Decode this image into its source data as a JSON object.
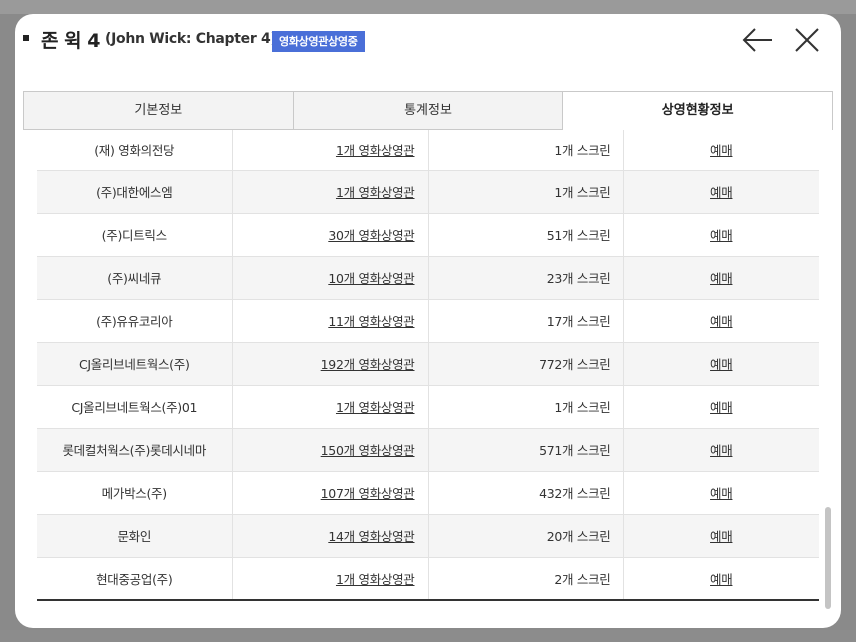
{
  "header": {
    "title": "존 윅 4",
    "subtitle": "(John Wick: Chapter 4)",
    "badge": "영화상영관상영중"
  },
  "tabs": [
    {
      "label": "기본정보",
      "active": false
    },
    {
      "label": "통계정보",
      "active": false
    },
    {
      "label": "상영현황정보",
      "active": true
    }
  ],
  "rows": [
    {
      "company": "(재) 영화의전당",
      "theaters": "1개 영화상영관",
      "screens": "1개 스크린",
      "action": "예매"
    },
    {
      "company": "(주)대한에스엠",
      "theaters": "1개 영화상영관",
      "screens": "1개 스크린",
      "action": "예매"
    },
    {
      "company": "(주)디트릭스",
      "theaters": "30개 영화상영관",
      "screens": "51개 스크린",
      "action": "예매"
    },
    {
      "company": "(주)씨네큐",
      "theaters": "10개 영화상영관",
      "screens": "23개 스크린",
      "action": "예매"
    },
    {
      "company": "(주)유유코리아",
      "theaters": "11개 영화상영관",
      "screens": "17개 스크린",
      "action": "예매"
    },
    {
      "company": "CJ올리브네트웍스(주)",
      "theaters": "192개 영화상영관",
      "screens": "772개 스크린",
      "action": "예매"
    },
    {
      "company": "CJ올리브네트웍스(주)01",
      "theaters": "1개 영화상영관",
      "screens": "1개 스크린",
      "action": "예매"
    },
    {
      "company": "롯데컬처웍스(주)롯데시네마",
      "theaters": "150개 영화상영관",
      "screens": "571개 스크린",
      "action": "예매"
    },
    {
      "company": "메가박스(주)",
      "theaters": "107개 영화상영관",
      "screens": "432개 스크린",
      "action": "예매"
    },
    {
      "company": "문화인",
      "theaters": "14개 영화상영관",
      "screens": "20개 스크린",
      "action": "예매"
    },
    {
      "company": "현대중공업(주)",
      "theaters": "1개 영화상영관",
      "screens": "2개 스크린",
      "action": "예매"
    }
  ],
  "icons": {
    "back": "arrow-left-icon",
    "close": "close-icon"
  },
  "colors": {
    "badge": "#4a6fd8",
    "active_tab_bg": "#ffffff",
    "inactive_tab_bg": "#f3f3f3",
    "zebra": "#f5f5f5"
  }
}
